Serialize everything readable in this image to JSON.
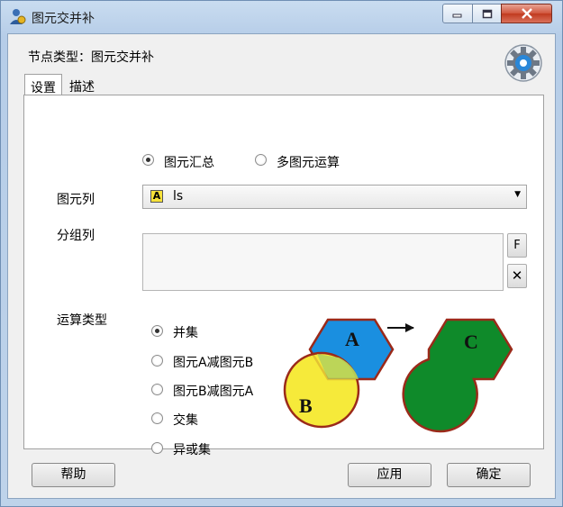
{
  "window": {
    "title": "图元交并补"
  },
  "header": {
    "node_type": "节点类型：图元交并补"
  },
  "tabs": [
    {
      "label": "设置"
    },
    {
      "label": "描述"
    }
  ],
  "mode": {
    "options": [
      {
        "label": "图元汇总",
        "checked": true
      },
      {
        "label": "多图元运算",
        "checked": false
      }
    ]
  },
  "feature_column": {
    "label": "图元列",
    "icon": "A",
    "value": "ls"
  },
  "group_column": {
    "label": "分组列",
    "f_button": "F",
    "clear_button": "✕"
  },
  "operation": {
    "label": "运算类型",
    "options": [
      {
        "label": "并集",
        "checked": true
      },
      {
        "label": "图元A减图元B",
        "checked": false
      },
      {
        "label": "图元B减图元A",
        "checked": false
      },
      {
        "label": "交集",
        "checked": false
      },
      {
        "label": "异或集",
        "checked": false
      }
    ]
  },
  "diagram": {
    "label_a": "A",
    "label_b": "B",
    "label_c": "C"
  },
  "footer": {
    "help": "帮助",
    "apply": "应用",
    "ok": "确定"
  },
  "colors": {
    "hexagon_a": "#1a8fe0",
    "circle_b": "#f6ea3a",
    "result_c": "#0f8a2a",
    "outline": "#9b2a1a"
  }
}
